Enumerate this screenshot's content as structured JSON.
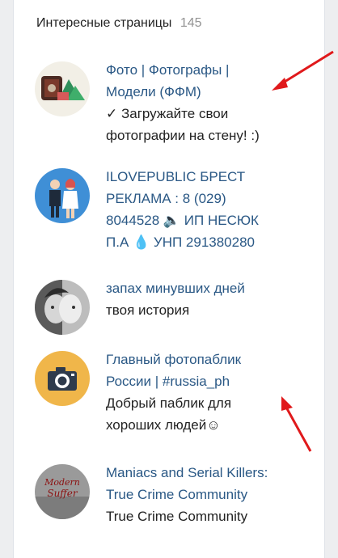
{
  "widget": {
    "title": "Интересные страницы",
    "count": "145"
  },
  "pages": [
    {
      "icon": "photo-models-avatar",
      "title_lines": [
        "Фото | Фотографы |",
        "Модели (ФФМ)"
      ],
      "desc_lines": [
        "✓ Загружайте свои",
        "фотографии на стену! :)"
      ]
    },
    {
      "icon": "couple-avatar",
      "title_lines": [
        "ILOVEPUBLIC БРЕСТ",
        "РЕКЛАМА : 8 (029)",
        "8044528 🔈 ИП НЕСЮК",
        "П.А 💧 УНП 291380280"
      ],
      "desc_lines": []
    },
    {
      "icon": "faces-avatar",
      "title_lines": [
        "запах минувших дней"
      ],
      "desc_lines": [
        "твоя история"
      ]
    },
    {
      "icon": "camera-avatar",
      "title_lines": [
        "Главный фотопаблик",
        "России | #russia_ph"
      ],
      "desc_lines": [
        "Добрый паблик для",
        "хороших людей☺"
      ]
    },
    {
      "icon": "maniacs-avatar",
      "title_lines": [
        "Maniacs and Serial Killers:",
        "True Crime Community"
      ],
      "desc_lines": [
        "True Crime Community"
      ]
    }
  ],
  "avatar_texts": {
    "maniacs_top": "Modern",
    "maniacs_bottom": "Suffer"
  },
  "colors": {
    "link": "#2a5885",
    "arrow": "#e0191b",
    "camera_bg": "#f0b64a"
  }
}
